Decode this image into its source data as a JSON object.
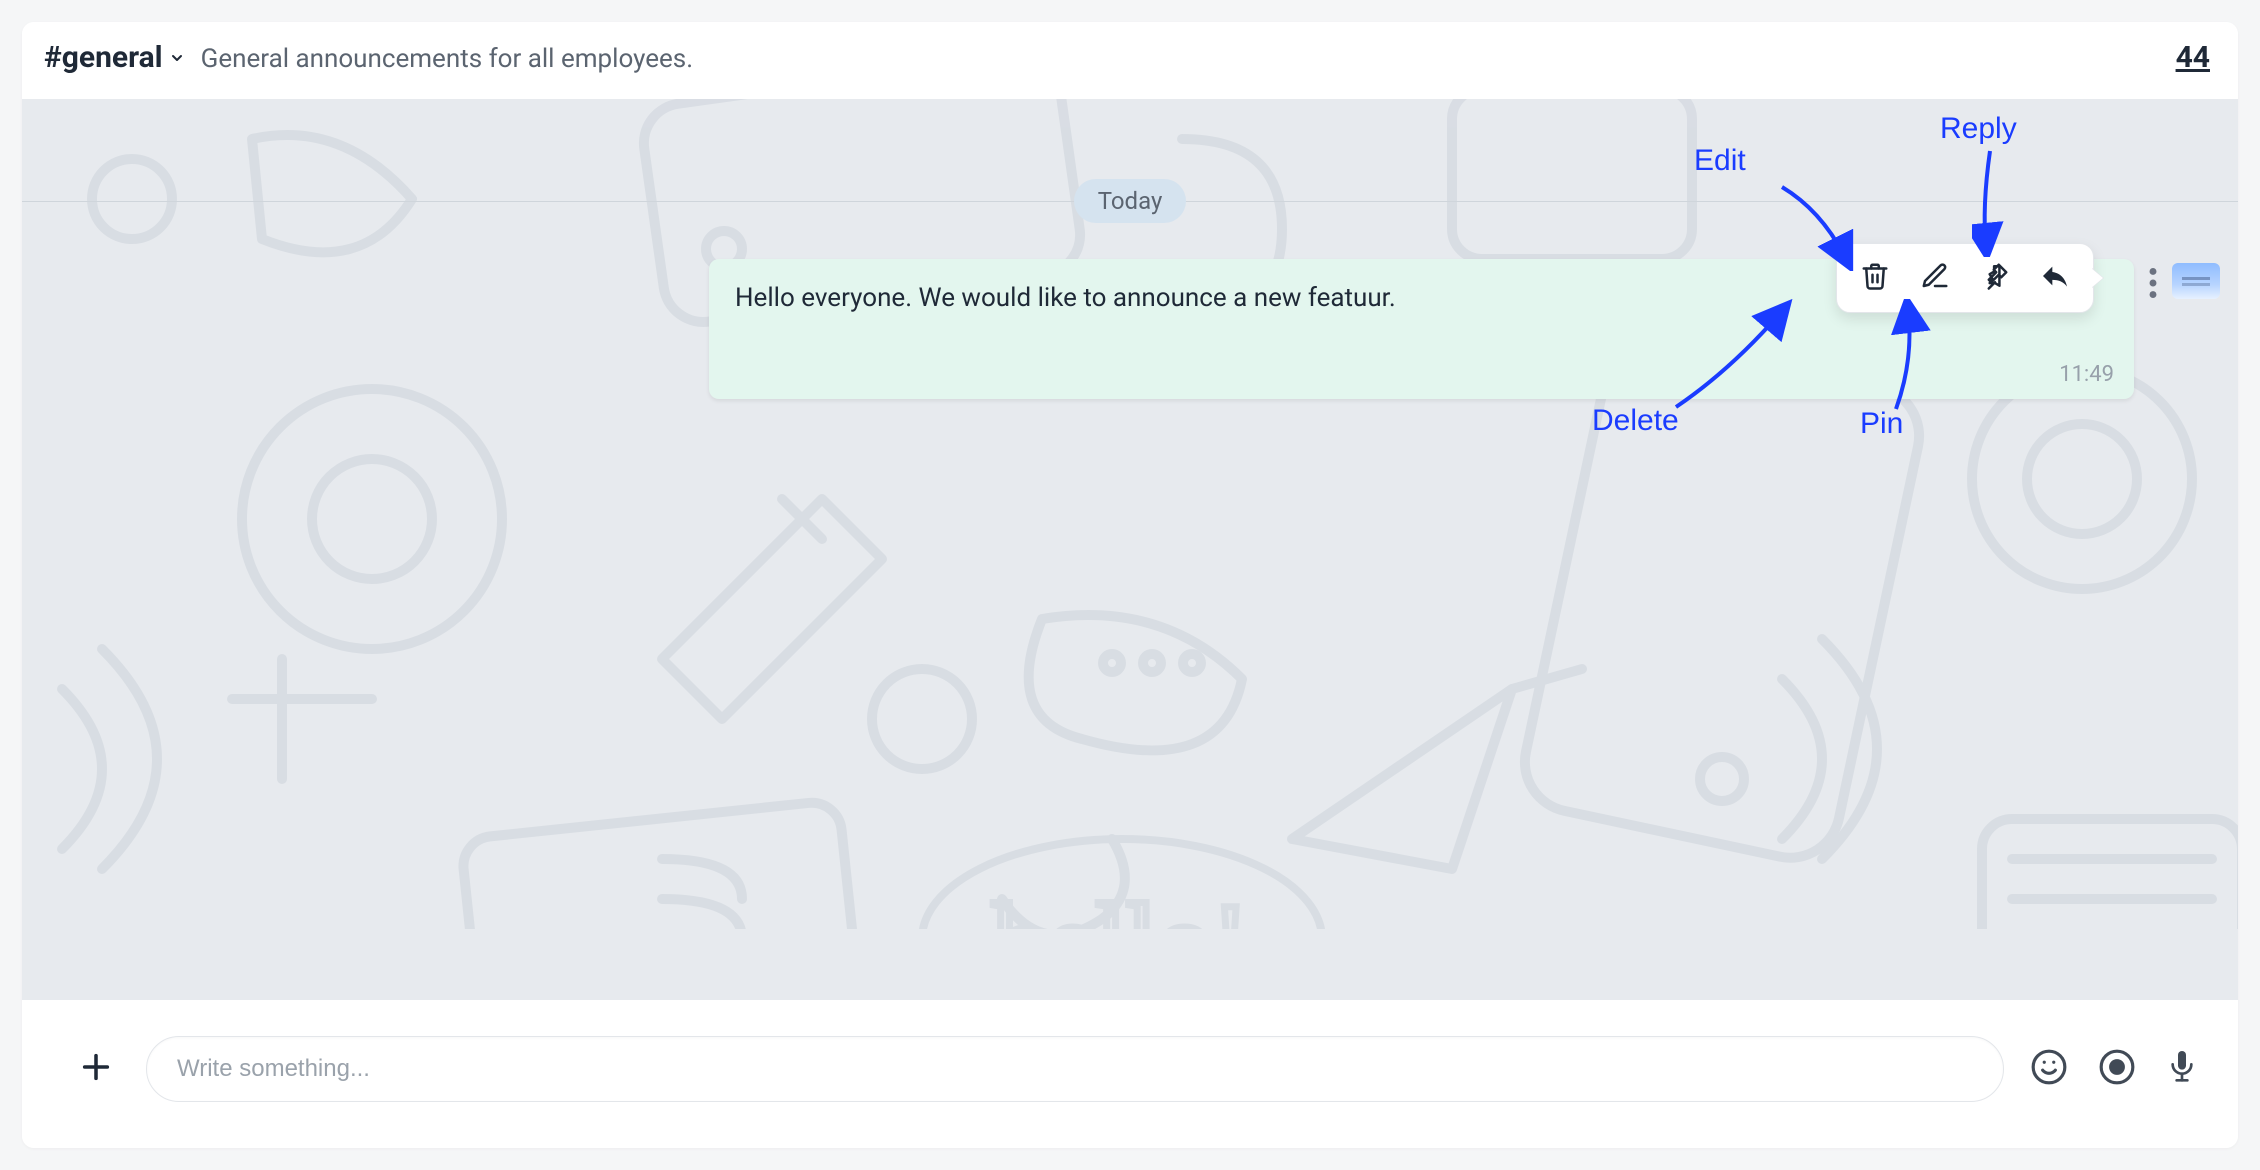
{
  "header": {
    "channel_name": "#general",
    "channel_desc": "General announcements for all employees.",
    "member_count": "44"
  },
  "date_separator": "Today",
  "message": {
    "text": "Hello everyone. We would like to announce a new featuur.",
    "time": "11:49"
  },
  "action_tooltips": {
    "delete": "Delete",
    "edit": "Edit",
    "pin": "Pin",
    "reply": "Reply"
  },
  "annotations": {
    "delete": "Delete",
    "edit": "Edit",
    "pin": "Pin",
    "reply": "Reply"
  },
  "composer": {
    "placeholder": "Write something..."
  },
  "icons": {
    "chevron_down": "chevron-down-icon",
    "trash": "trash-icon",
    "edit": "edit-icon",
    "pin": "pin-icon",
    "reply": "reply-icon",
    "more_vert": "more-vertical-icon",
    "plus": "plus-icon",
    "emoji": "emoji-icon",
    "record": "record-icon",
    "mic": "mic-icon"
  }
}
